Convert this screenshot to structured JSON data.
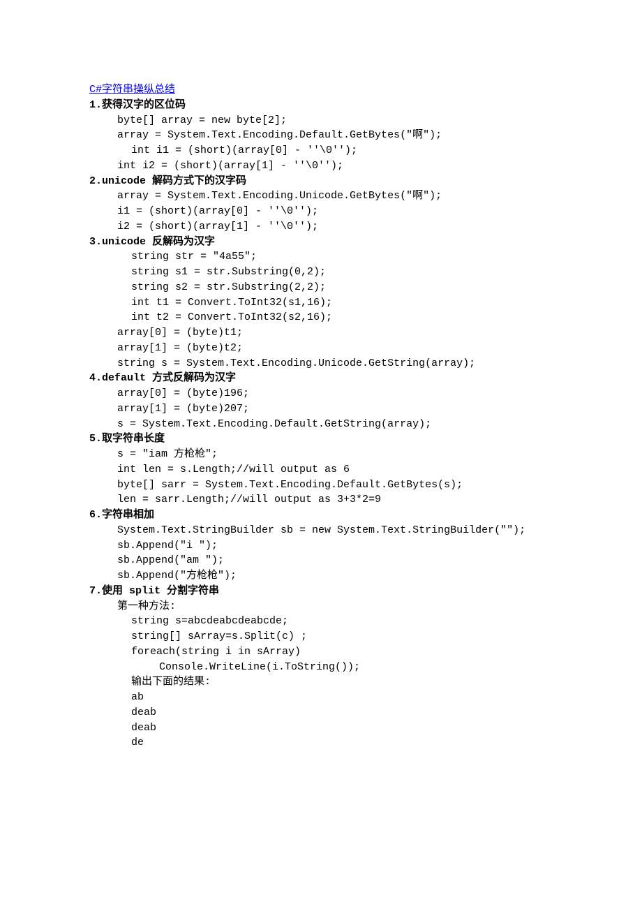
{
  "title": "C#字符串操纵总结",
  "sections": [
    {
      "heading": "1.获得汉字的区位码",
      "lines": [
        {
          "cls": "i1",
          "text": "byte[] array = new byte[2];"
        },
        {
          "cls": "i1",
          "text": "array = System.Text.Encoding.Default.GetBytes(\"啊\");"
        },
        {
          "cls": "i1b",
          "text": "int i1 = (short)(array[0] - ''\\0'');"
        },
        {
          "cls": "i1",
          "text": "int i2 = (short)(array[1] - ''\\0'');"
        }
      ]
    },
    {
      "heading": "2.unicode 解码方式下的汉字码",
      "lines": [
        {
          "cls": "i1",
          "text": "array = System.Text.Encoding.Unicode.GetBytes(\"啊\");"
        },
        {
          "cls": "i1",
          "text": "i1 = (short)(array[0] - ''\\0'');"
        },
        {
          "cls": "i1",
          "text": "i2 = (short)(array[1] - ''\\0'');"
        }
      ]
    },
    {
      "heading": "3.unicode 反解码为汉字",
      "lines": [
        {
          "cls": "i1b",
          "text": "string str = \"4a55\";"
        },
        {
          "cls": "i1b",
          "text": "string s1 = str.Substring(0,2);"
        },
        {
          "cls": "i1b",
          "text": "string s2 = str.Substring(2,2);"
        },
        {
          "cls": "i1b",
          "text": "int t1 = Convert.ToInt32(s1,16);"
        },
        {
          "cls": "i1b",
          "text": "int t2 = Convert.ToInt32(s2,16);"
        },
        {
          "cls": "i1",
          "text": "array[0] = (byte)t1;"
        },
        {
          "cls": "i1",
          "text": "array[1] = (byte)t2;"
        },
        {
          "cls": "i1",
          "text": "string s = System.Text.Encoding.Unicode.GetString(array);"
        }
      ]
    },
    {
      "heading": "4.default 方式反解码为汉字",
      "lines": [
        {
          "cls": "i1",
          "text": "array[0] = (byte)196;"
        },
        {
          "cls": "i1",
          "text": "array[1] = (byte)207;"
        },
        {
          "cls": "i1",
          "text": "s = System.Text.Encoding.Default.GetString(array);"
        }
      ]
    },
    {
      "heading": "5.取字符串长度",
      "lines": [
        {
          "cls": "i1",
          "text": "s = \"iam 方枪枪\";"
        },
        {
          "cls": "i1",
          "text": "int len = s.Length;//will output as 6"
        },
        {
          "cls": "i1",
          "text": "byte[] sarr = System.Text.Encoding.Default.GetBytes(s);"
        },
        {
          "cls": "i1",
          "text": "len = sarr.Length;//will output as 3+3*2=9"
        }
      ]
    },
    {
      "heading": "6.字符串相加",
      "lines": [
        {
          "cls": "i1",
          "text": "System.Text.StringBuilder sb = new System.Text.StringBuilder(\"\");"
        },
        {
          "cls": "i1",
          "text": "sb.Append(\"i \");"
        },
        {
          "cls": "i1",
          "text": "sb.Append(\"am \");"
        },
        {
          "cls": "i1",
          "text": "sb.Append(\"方枪枪\");"
        }
      ]
    },
    {
      "heading": "7.使用 split 分割字符串",
      "lines": [
        {
          "cls": "i1",
          "text": "第一种方法:"
        },
        {
          "cls": "i2",
          "text": "string s=abcdeabcdeabcde;"
        },
        {
          "cls": "i2",
          "text": "string[] sArray=s.Split(c) ;"
        },
        {
          "cls": "i2",
          "text": "foreach(string i in sArray)"
        },
        {
          "cls": "i3",
          "text": "Console.WriteLine(i.ToString());"
        },
        {
          "cls": "i2",
          "text": "输出下面的结果:"
        },
        {
          "cls": "i2",
          "text": "ab"
        },
        {
          "cls": "i2",
          "text": "deab"
        },
        {
          "cls": "i2",
          "text": "deab"
        },
        {
          "cls": "i2",
          "text": "de"
        }
      ]
    }
  ]
}
